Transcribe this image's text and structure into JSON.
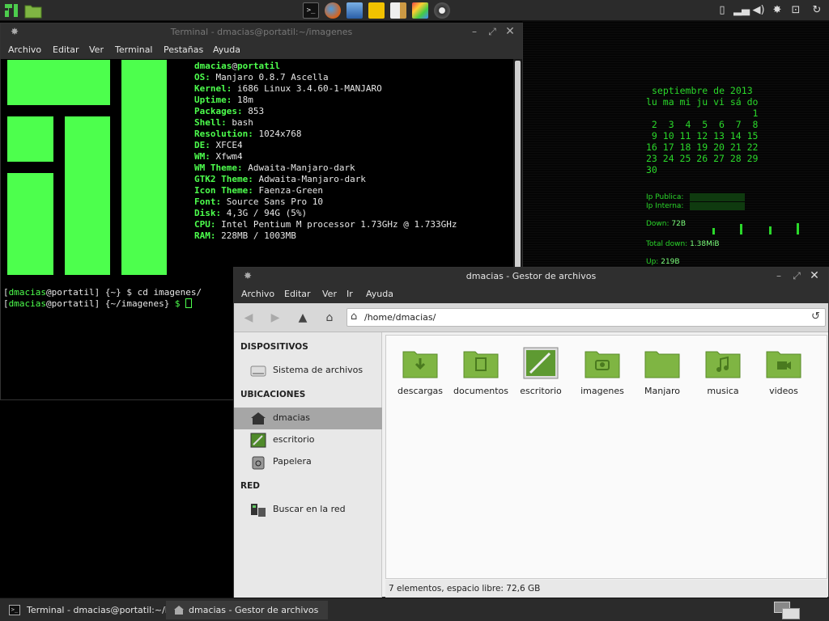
{
  "terminal": {
    "title": "Terminal - dmacias@portatil:~/imagenes",
    "menu": [
      "Archivo",
      "Editar",
      "Ver",
      "Terminal",
      "Pestañas",
      "Ayuda"
    ],
    "user": "dmacias",
    "at": "@",
    "host": "portatil",
    "info": [
      {
        "key": "OS:",
        "value": " Manjaro 0.8.7 Ascella"
      },
      {
        "key": "Kernel:",
        "value": " i686 Linux 3.4.60-1-MANJARO"
      },
      {
        "key": "Uptime:",
        "value": " 18m"
      },
      {
        "key": "Packages:",
        "value": " 853"
      },
      {
        "key": "Shell:",
        "value": " bash"
      },
      {
        "key": "Resolution:",
        "value": " 1024x768"
      },
      {
        "key": "DE:",
        "value": " XFCE4"
      },
      {
        "key": "WM:",
        "value": " Xfwm4"
      },
      {
        "key": "WM Theme:",
        "value": " Adwaita-Manjaro-dark"
      },
      {
        "key": "GTK2 Theme:",
        "value": " Adwaita-Manjaro-dark"
      },
      {
        "key": "Icon Theme:",
        "value": " Faenza-Green"
      },
      {
        "key": "Font:",
        "value": " Source Sans Pro 10"
      },
      {
        "key": "Disk:",
        "value": " 4,3G / 94G (5%)"
      },
      {
        "key": "CPU:",
        "value": " Intel Pentium M processor 1.73GHz @ 1.733GHz"
      },
      {
        "key": "RAM:",
        "value": " 228MB / 1003MB"
      }
    ],
    "prompt1": {
      "open": "[",
      "user": "dmacias",
      "at": "@portatil",
      "close": "]",
      "dir": " {~}",
      "sym": " $",
      "cmd": " cd imagenes/"
    },
    "prompt2": {
      "open": "[",
      "user": "dmacias",
      "at": "@portatil",
      "close": "]",
      "dir": " {~/imagenes}",
      "sym": " $",
      "cmd": " "
    }
  },
  "conky": {
    "calendar_title": "septiembre de 2013",
    "calendar_rows": [
      "lu ma mi ju vi sá do",
      "                   1",
      " 2  3  4  5  6  7  8",
      " 9 10 11 12 13 14 15",
      "16 17 18 19 20 21 22",
      "23 24 25 26 27 28 29",
      "30"
    ],
    "ip_publica_label": "Ip Publica:",
    "ip_interna_label": "Ip Interna:",
    "down_label": "Down:",
    "down_value": "72B",
    "total_down_label": "Total down:",
    "total_down_value": "1.38MiB",
    "up_label": "Up:",
    "up_value": "219B"
  },
  "file_manager": {
    "title": "dmacias - Gestor de archivos",
    "menu": [
      "Archivo",
      "Editar",
      "Ver",
      "Ir",
      "Ayuda"
    ],
    "path": "/home/dmacias/",
    "sidebar": {
      "devices_header": "DISPOSITIVOS",
      "devices": [
        {
          "label": "Sistema de archivos"
        }
      ],
      "places_header": "UBICACIONES",
      "places": [
        {
          "label": "dmacias",
          "selected": true
        },
        {
          "label": "escritorio"
        },
        {
          "label": "Papelera"
        }
      ],
      "network_header": "RED",
      "network": [
        {
          "label": "Buscar en la red"
        }
      ]
    },
    "folders": [
      {
        "name": "descargas",
        "icon": "download-folder-icon"
      },
      {
        "name": "documentos",
        "icon": "documents-folder-icon"
      },
      {
        "name": "escritorio",
        "icon": "desktop-folder-icon"
      },
      {
        "name": "imagenes",
        "icon": "pictures-folder-icon"
      },
      {
        "name": "Manjaro",
        "icon": "folder-icon"
      },
      {
        "name": "musica",
        "icon": "music-folder-icon"
      },
      {
        "name": "videos",
        "icon": "videos-folder-icon"
      }
    ],
    "status": "7 elementos, espacio libre: 72,6 GB"
  },
  "taskbar": {
    "tasks": [
      {
        "label": "Terminal - dmacias@portatil:~/i..."
      },
      {
        "label": "dmacias - Gestor de archivos"
      }
    ]
  },
  "colors": {
    "accent_green": "#4dff4d",
    "folder_green": "#7fb543",
    "panel": "#2b2b2b"
  }
}
